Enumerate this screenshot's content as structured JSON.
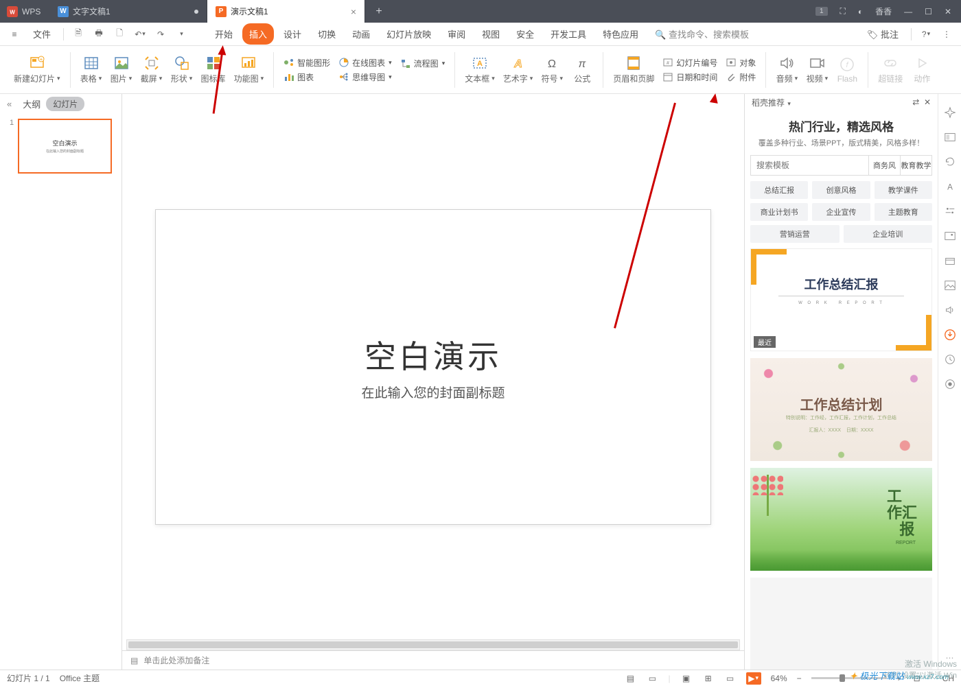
{
  "titlebar": {
    "brand": "WPS",
    "tabs": [
      {
        "label": "文字文稿1",
        "icon_color": "#4a90d9",
        "icon_letter": "W"
      },
      {
        "label": "演示文稿1",
        "icon_color": "#f56a24",
        "icon_letter": "P"
      }
    ],
    "badge": "1",
    "user": "香香"
  },
  "menu": {
    "file": "文件",
    "items": [
      "开始",
      "插入",
      "设计",
      "切换",
      "动画",
      "幻灯片放映",
      "审阅",
      "视图",
      "安全",
      "开发工具",
      "特色应用"
    ],
    "active": "插入",
    "search": "查找命令、搜索模板",
    "annotate": "批注"
  },
  "ribbon": {
    "new_slide": "新建幻灯片",
    "table": "表格",
    "picture": "图片",
    "screenshot": "截屏",
    "shape": "形状",
    "icon_lib": "图标库",
    "func_chart": "功能图",
    "smart_art": "智能图形",
    "online_chart": "在线图表",
    "chart": "图表",
    "flow": "流程图",
    "mindmap": "思维导图",
    "textbox": "文本框",
    "wordart": "艺术字",
    "symbol": "符号",
    "formula": "公式",
    "header_footer": "页眉和页脚",
    "slide_num": "幻灯片编号",
    "datetime": "日期和时间",
    "object": "对象",
    "attachment": "附件",
    "audio": "音频",
    "video": "视频",
    "flash": "Flash",
    "hyperlink": "超链接",
    "action": "动作"
  },
  "left": {
    "outline": "大纲",
    "slides": "幻灯片",
    "thumb_title": "空白演示",
    "thumb_sub": "在此输入您的封面副标题"
  },
  "slide": {
    "title": "空白演示",
    "subtitle": "在此输入您的封面副标题"
  },
  "notes": {
    "placeholder": "单击此处添加备注"
  },
  "right": {
    "head": "稻壳推荐",
    "title": "热门行业，精选风格",
    "sub": "覆盖多种行业、场景PPT，版式精美，风格多样！",
    "search_ph": "搜索模板",
    "filters": [
      "商务风",
      "教育教学"
    ],
    "chips": [
      "总结汇报",
      "创意风格",
      "教学课件",
      "商业计划书",
      "企业宣传",
      "主题教育",
      "营销运营",
      "企业培训"
    ],
    "tpl1": "工作总结汇报",
    "tpl1_badge": "最近",
    "tpl2": "工作总结计划",
    "tpl3a": "工",
    "tpl3b": "作汇",
    "tpl3c": "报"
  },
  "status": {
    "slide_count": "幻灯片 1 / 1",
    "theme": "Office 主题",
    "zoom": "64%",
    "lang": "CH"
  },
  "watermark": {
    "l1": "激活 Windows",
    "l2": "转到\"设置\"以激活 Win",
    "brand": "极光下载站",
    "url": "www.xz7.com"
  }
}
